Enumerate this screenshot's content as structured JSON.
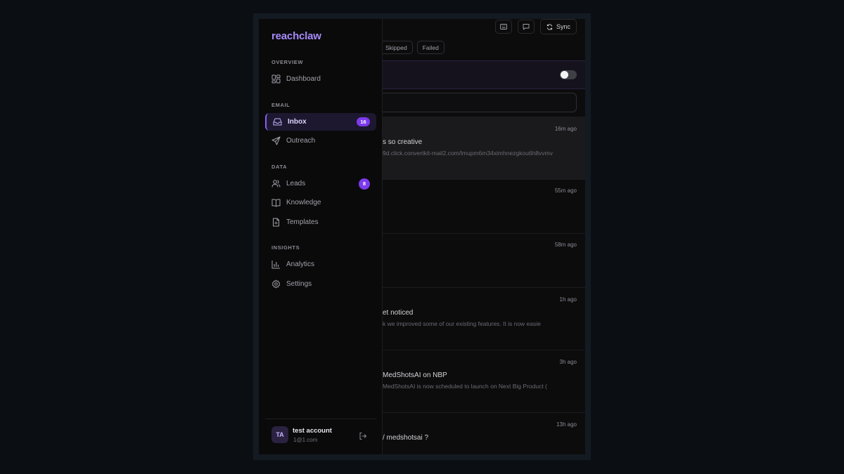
{
  "toolbar": {
    "sync_label": "Sync"
  },
  "filters": {
    "skipped": "Skipped",
    "failed": "Failed"
  },
  "mails": [
    {
      "time": "16m ago",
      "subject": "s so creative",
      "preview": "9d.click.convertkit-mail2.com/lmupm6m34ximhnezgkou6h8vvmv"
    },
    {
      "time": "55m ago",
      "subject": "",
      "preview": ""
    },
    {
      "time": "58m ago",
      "subject": "",
      "preview": ""
    },
    {
      "time": "1h ago",
      "subject": "et noticed",
      "preview": "k we improved some of our existing features. It is now easie"
    },
    {
      "time": "3h ago",
      "subject": "MedShotsAI on NBP",
      "preview": "MedShotsAI is now scheduled to launch on Next Big Product ("
    },
    {
      "time": "13h ago",
      "subject": "/ medshotsai ?",
      "preview": ""
    }
  ],
  "sidebar": {
    "brand": "reachclaw",
    "sections": {
      "overview": "OVERVIEW",
      "email": "EMAIL",
      "data": "DATA",
      "insights": "INSIGHTS"
    },
    "items": {
      "dashboard": {
        "label": "Dashboard",
        "icon": "dashboard-icon"
      },
      "inbox": {
        "label": "Inbox",
        "icon": "inbox-icon",
        "badge": "16"
      },
      "outreach": {
        "label": "Outreach",
        "icon": "send-icon"
      },
      "leads": {
        "label": "Leads",
        "icon": "users-icon",
        "badge": "8"
      },
      "knowledge": {
        "label": "Knowledge",
        "icon": "book-icon"
      },
      "templates": {
        "label": "Templates",
        "icon": "file-text-icon"
      },
      "analytics": {
        "label": "Analytics",
        "icon": "bar-chart-icon"
      },
      "settings": {
        "label": "Settings",
        "icon": "gear-icon"
      }
    }
  },
  "user": {
    "initials": "TA",
    "name": "test account",
    "email": "1@1.com"
  },
  "colors": {
    "accent": "#8b5cf6",
    "badge": "#7c3aed",
    "brand": "#a78bfa",
    "background": "#0a0a0b"
  }
}
